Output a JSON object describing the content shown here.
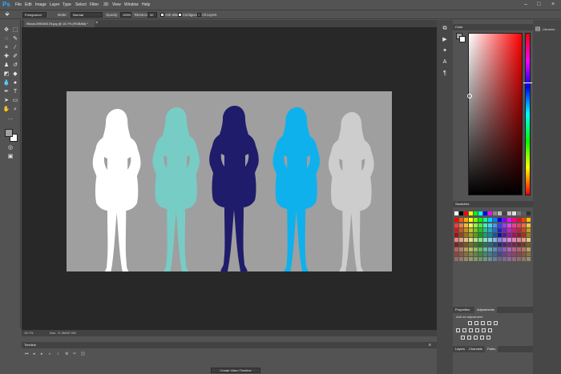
{
  "app": {
    "logo": "Ps"
  },
  "menu": {
    "items": [
      "File",
      "Edit",
      "Image",
      "Layer",
      "Type",
      "Select",
      "Filter",
      "3D",
      "View",
      "Window",
      "Help"
    ]
  },
  "window_controls": {
    "minimize": "–",
    "maximize": "□",
    "close": "×"
  },
  "options_bar": {
    "sample_value": "Foreground",
    "mode_label": "Mode:",
    "mode_value": "Normal",
    "opacity_label": "Opacity:",
    "opacity_value": "100%",
    "tolerance_label": "Tolerance:",
    "tolerance_value": "32",
    "antialias_label": "Anti-alias",
    "contiguous_label": "Contiguous",
    "all_layers_label": "All Layers"
  },
  "document": {
    "tab_title": "iStock-599165178.jpg @ 15.7% (RGB/8#) *",
    "zoom": "15.7%",
    "doc_info": "Doc: 71.3M/57.0M",
    "background": "#9f9f9f",
    "silhouettes": [
      {
        "color": "#ffffff"
      },
      {
        "color": "#77cdc6"
      },
      {
        "color": "#1f1c6b"
      },
      {
        "color": "#0fb1ed"
      },
      {
        "color": "#cdcdcd"
      }
    ]
  },
  "timeline": {
    "title": "Timeline",
    "create_button": "Create Video Timeline"
  },
  "panels": {
    "color": {
      "title": "Color",
      "hue_marker": 0.3
    },
    "swatches": {
      "title": "Swatches"
    },
    "libraries": {
      "title": "Libraries"
    },
    "adjustments": {
      "tab_properties": "Properties",
      "tab_adjustments": "Adjustments",
      "hint": "Add an adjustment"
    },
    "layers": {
      "tab_layers": "Layers",
      "tab_channels": "Channels",
      "tab_paths": "Paths"
    }
  },
  "colors": {
    "foreground": "#a0a0a0",
    "background": "#ffffff"
  }
}
